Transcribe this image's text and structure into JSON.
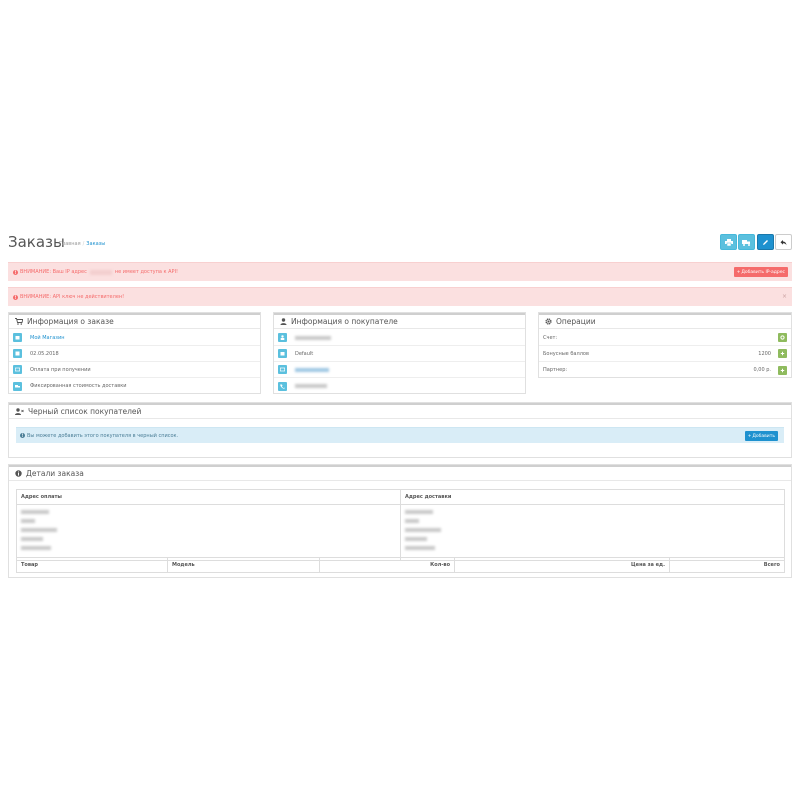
{
  "header": {
    "title": "Заказы",
    "breadcrumb_home": "Главная",
    "breadcrumb_sep": "/",
    "breadcrumb_current": "Заказы"
  },
  "toolbar": {
    "icons": [
      "print-icon",
      "truck-icon",
      "pencil-icon",
      "reply-icon"
    ]
  },
  "alerts": {
    "ip_warning_prefix": "ВНИМАНИЕ: Ваш IP адрес",
    "ip_warning_suffix": "не имеет доступа к API!",
    "add_ip_button": "Добавить IP-адрес",
    "api_key_warning": "ВНИМАНИЕ: API ключ не действителен!",
    "close": "×"
  },
  "order_info": {
    "title": "Информация о заказе",
    "store": "Мой Магазин",
    "date": "02.05.2018",
    "payment": "Оплата при получении",
    "shipping": "Фиксированная стоимость доставки"
  },
  "customer_info": {
    "title": "Информация о покупателе",
    "group": "Default"
  },
  "operations": {
    "title": "Операции",
    "invoice_label": "Счет:",
    "reward_label": "Бонусные баллов",
    "reward_value": "1200",
    "affiliate_label": "Партнер:",
    "affiliate_value": "0,00 р."
  },
  "blacklist": {
    "title": "Черный список покупателей",
    "info": "Вы можете добавить этого покупателя в черный список.",
    "add_button": "Добавить"
  },
  "order_details": {
    "title": "Детали заказа",
    "payment_address": "Адрес оплаты",
    "shipping_address": "Адрес доставки",
    "columns": [
      "Товар",
      "Модель",
      "Кол-во",
      "Цена за ед.",
      "Всего"
    ]
  },
  "colors": {
    "primary": "#1e91cf",
    "info": "#5bc0de",
    "danger": "#f56b6b",
    "success": "#8fbb5e"
  }
}
